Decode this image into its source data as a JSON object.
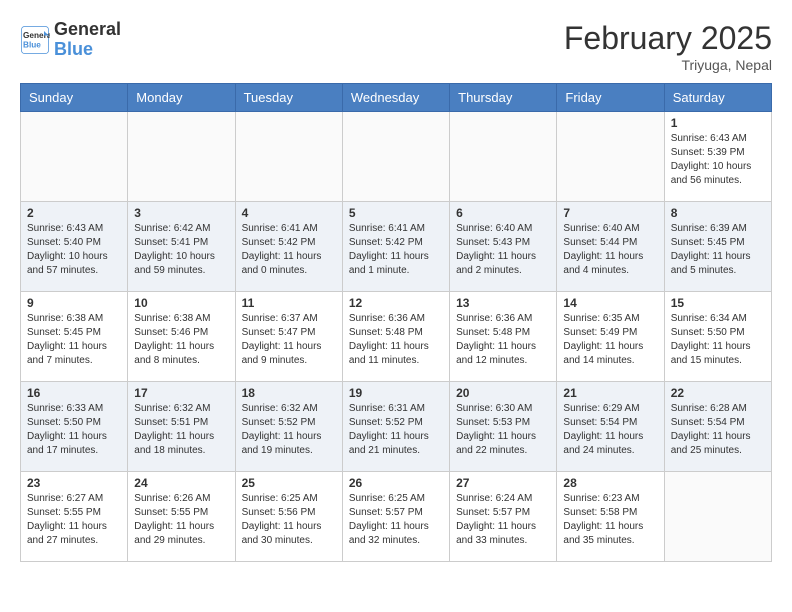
{
  "header": {
    "logo_line1": "General",
    "logo_line2": "Blue",
    "month_title": "February 2025",
    "location": "Triyuga, Nepal"
  },
  "weekdays": [
    "Sunday",
    "Monday",
    "Tuesday",
    "Wednesday",
    "Thursday",
    "Friday",
    "Saturday"
  ],
  "weeks": [
    [
      {
        "day": "",
        "info": ""
      },
      {
        "day": "",
        "info": ""
      },
      {
        "day": "",
        "info": ""
      },
      {
        "day": "",
        "info": ""
      },
      {
        "day": "",
        "info": ""
      },
      {
        "day": "",
        "info": ""
      },
      {
        "day": "1",
        "info": "Sunrise: 6:43 AM\nSunset: 5:39 PM\nDaylight: 10 hours and 56 minutes."
      }
    ],
    [
      {
        "day": "2",
        "info": "Sunrise: 6:43 AM\nSunset: 5:40 PM\nDaylight: 10 hours and 57 minutes."
      },
      {
        "day": "3",
        "info": "Sunrise: 6:42 AM\nSunset: 5:41 PM\nDaylight: 10 hours and 59 minutes."
      },
      {
        "day": "4",
        "info": "Sunrise: 6:41 AM\nSunset: 5:42 PM\nDaylight: 11 hours and 0 minutes."
      },
      {
        "day": "5",
        "info": "Sunrise: 6:41 AM\nSunset: 5:42 PM\nDaylight: 11 hours and 1 minute."
      },
      {
        "day": "6",
        "info": "Sunrise: 6:40 AM\nSunset: 5:43 PM\nDaylight: 11 hours and 2 minutes."
      },
      {
        "day": "7",
        "info": "Sunrise: 6:40 AM\nSunset: 5:44 PM\nDaylight: 11 hours and 4 minutes."
      },
      {
        "day": "8",
        "info": "Sunrise: 6:39 AM\nSunset: 5:45 PM\nDaylight: 11 hours and 5 minutes."
      }
    ],
    [
      {
        "day": "9",
        "info": "Sunrise: 6:38 AM\nSunset: 5:45 PM\nDaylight: 11 hours and 7 minutes."
      },
      {
        "day": "10",
        "info": "Sunrise: 6:38 AM\nSunset: 5:46 PM\nDaylight: 11 hours and 8 minutes."
      },
      {
        "day": "11",
        "info": "Sunrise: 6:37 AM\nSunset: 5:47 PM\nDaylight: 11 hours and 9 minutes."
      },
      {
        "day": "12",
        "info": "Sunrise: 6:36 AM\nSunset: 5:48 PM\nDaylight: 11 hours and 11 minutes."
      },
      {
        "day": "13",
        "info": "Sunrise: 6:36 AM\nSunset: 5:48 PM\nDaylight: 11 hours and 12 minutes."
      },
      {
        "day": "14",
        "info": "Sunrise: 6:35 AM\nSunset: 5:49 PM\nDaylight: 11 hours and 14 minutes."
      },
      {
        "day": "15",
        "info": "Sunrise: 6:34 AM\nSunset: 5:50 PM\nDaylight: 11 hours and 15 minutes."
      }
    ],
    [
      {
        "day": "16",
        "info": "Sunrise: 6:33 AM\nSunset: 5:50 PM\nDaylight: 11 hours and 17 minutes."
      },
      {
        "day": "17",
        "info": "Sunrise: 6:32 AM\nSunset: 5:51 PM\nDaylight: 11 hours and 18 minutes."
      },
      {
        "day": "18",
        "info": "Sunrise: 6:32 AM\nSunset: 5:52 PM\nDaylight: 11 hours and 19 minutes."
      },
      {
        "day": "19",
        "info": "Sunrise: 6:31 AM\nSunset: 5:52 PM\nDaylight: 11 hours and 21 minutes."
      },
      {
        "day": "20",
        "info": "Sunrise: 6:30 AM\nSunset: 5:53 PM\nDaylight: 11 hours and 22 minutes."
      },
      {
        "day": "21",
        "info": "Sunrise: 6:29 AM\nSunset: 5:54 PM\nDaylight: 11 hours and 24 minutes."
      },
      {
        "day": "22",
        "info": "Sunrise: 6:28 AM\nSunset: 5:54 PM\nDaylight: 11 hours and 25 minutes."
      }
    ],
    [
      {
        "day": "23",
        "info": "Sunrise: 6:27 AM\nSunset: 5:55 PM\nDaylight: 11 hours and 27 minutes."
      },
      {
        "day": "24",
        "info": "Sunrise: 6:26 AM\nSunset: 5:55 PM\nDaylight: 11 hours and 29 minutes."
      },
      {
        "day": "25",
        "info": "Sunrise: 6:25 AM\nSunset: 5:56 PM\nDaylight: 11 hours and 30 minutes."
      },
      {
        "day": "26",
        "info": "Sunrise: 6:25 AM\nSunset: 5:57 PM\nDaylight: 11 hours and 32 minutes."
      },
      {
        "day": "27",
        "info": "Sunrise: 6:24 AM\nSunset: 5:57 PM\nDaylight: 11 hours and 33 minutes."
      },
      {
        "day": "28",
        "info": "Sunrise: 6:23 AM\nSunset: 5:58 PM\nDaylight: 11 hours and 35 minutes."
      },
      {
        "day": "",
        "info": ""
      }
    ]
  ]
}
